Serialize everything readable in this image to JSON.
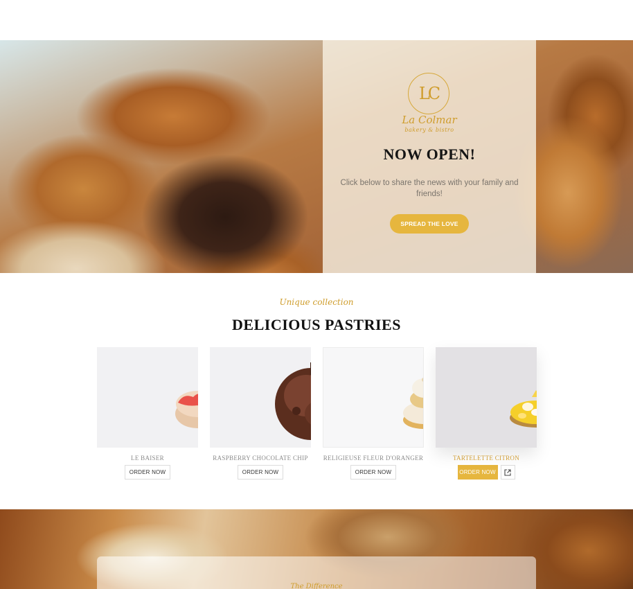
{
  "hero": {
    "logo_monogram": "LC",
    "logo_name": "La Colmar",
    "logo_sub": "bakery & bistro",
    "title": "NOW OPEN!",
    "text": "Click below to share the news with your family and friends!",
    "button_label": "SPREAD THE LOVE"
  },
  "collection": {
    "kicker": "Unique collection",
    "title": "DELICIOUS PASTRIES",
    "products": [
      {
        "name": "LE BAISER",
        "button": "ORDER NOW"
      },
      {
        "name": "RASPBERRY CHOCOLATE CHIP",
        "button": "ORDER NOW"
      },
      {
        "name": "RELIGIEUSE FLEUR D'ORANGER",
        "button": "ORDER NOW"
      },
      {
        "name": "TARTELETTE CITRON",
        "button": "ORDER NOW"
      }
    ]
  },
  "bottom": {
    "kicker": "The Difference"
  },
  "colors": {
    "accent": "#e6b63e",
    "gold_text": "#cf9d2c"
  }
}
